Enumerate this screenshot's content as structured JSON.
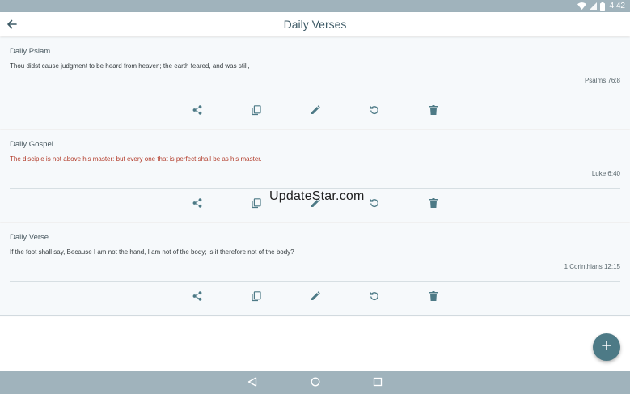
{
  "status_bar": {
    "time": "4:42",
    "icons": [
      "wifi-icon",
      "signal-icon",
      "battery-icon"
    ]
  },
  "app_bar": {
    "title": "Daily Verses",
    "back_icon": "arrow-back-icon"
  },
  "cards": [
    {
      "title": "Daily Pslam",
      "text": "Thou didst cause judgment to be heard from heaven; the earth feared, and was still,",
      "reference": "Psalms 76:8",
      "text_color": "#333a3d"
    },
    {
      "title": "Daily Gospel",
      "text": "The disciple is not above his master: but every one that is perfect shall be as his master.",
      "reference": "Luke 6:40",
      "text_color": "#b23a28"
    },
    {
      "title": "Daily Verse",
      "text": "If the foot shall say, Because I am not the hand, I am not of the body; is it therefore not of the body?",
      "reference": "1 Corinthians 12:15",
      "text_color": "#333a3d"
    }
  ],
  "card_actions": [
    "share-icon",
    "copy-icon",
    "edit-icon",
    "refresh-icon",
    "delete-icon"
  ],
  "watermark": "UpdateStar.com",
  "fab": {
    "icon": "plus-icon"
  },
  "nav_bar": {
    "icons": [
      "back-triangle-icon",
      "home-circle-icon",
      "recents-square-icon"
    ]
  },
  "colors": {
    "accent": "#4d7a86",
    "bars": "#a0b3bc",
    "card_background": "#f6f9fb",
    "title_text": "#3d5a66"
  }
}
